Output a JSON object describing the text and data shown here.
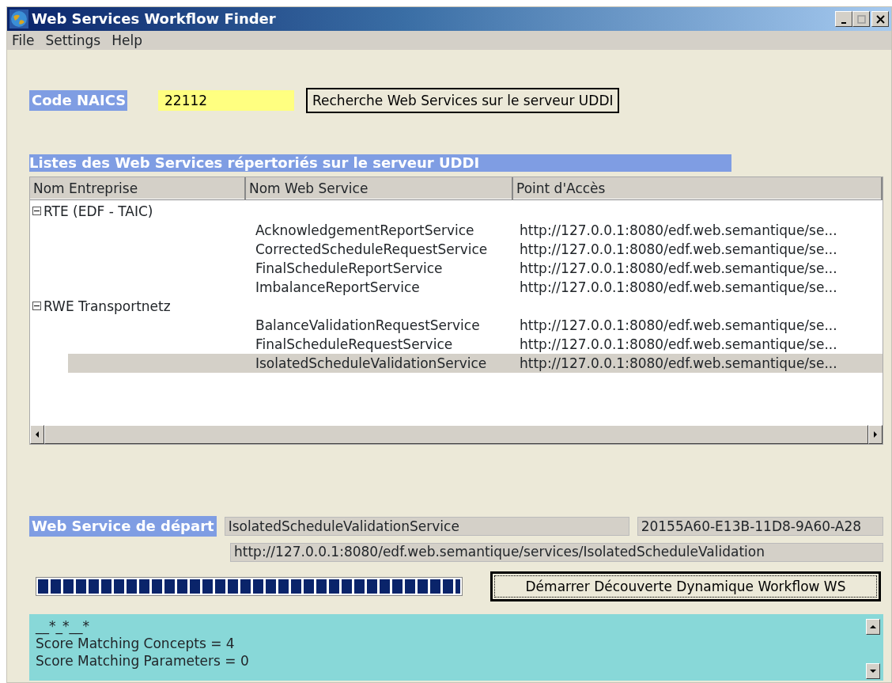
{
  "window": {
    "title": "Web Services Workflow Finder"
  },
  "menu": [
    "File",
    "Settings",
    "Help"
  ],
  "naics": {
    "label": "Code NAICS",
    "value": "22112",
    "button": "Recherche Web Services sur le serveur UDDI"
  },
  "list": {
    "title": "Listes des Web Services répertoriés sur le serveur UDDI",
    "columns": [
      "Nom Entreprise",
      "Nom Web Service",
      "Point d'Accès"
    ],
    "companies": [
      {
        "name": "RTE (EDF - TAIC)",
        "expanded": true,
        "children": [
          {
            "service": "AcknowledgementReportService",
            "url": "http://127.0.0.1:8080/edf.web.semantique/se...",
            "selected": false
          },
          {
            "service": "CorrectedScheduleRequestService",
            "url": "http://127.0.0.1:8080/edf.web.semantique/se...",
            "selected": false
          },
          {
            "service": "FinalScheduleReportService",
            "url": "http://127.0.0.1:8080/edf.web.semantique/se...",
            "selected": false
          },
          {
            "service": "ImbalanceReportService",
            "url": "http://127.0.0.1:8080/edf.web.semantique/se...",
            "selected": false
          }
        ]
      },
      {
        "name": "RWE Transportnetz",
        "expanded": true,
        "children": [
          {
            "service": "BalanceValidationRequestService",
            "url": "http://127.0.0.1:8080/edf.web.semantique/se...",
            "selected": false
          },
          {
            "service": "FinalScheduleRequestService",
            "url": "http://127.0.0.1:8080/edf.web.semantique/se...",
            "selected": false
          },
          {
            "service": "IsolatedScheduleValidationService",
            "url": "http://127.0.0.1:8080/edf.web.semantique/se...",
            "selected": true
          }
        ]
      }
    ]
  },
  "start": {
    "label": "Web Service de départ",
    "name": "IsolatedScheduleValidationService",
    "key": "20155A60-E13B-11D8-9A60-A28",
    "url": "http://127.0.0.1:8080/edf.web.semantique/services/IsolatedScheduleValidation"
  },
  "progress": {
    "level": 1.0
  },
  "discover_button": "Démarrer Découverte Dynamique Workflow WS",
  "output": [
    "__*_*__*",
    "Score Matching Concepts = 4",
    "Score Matching Parameters = 0"
  ]
}
